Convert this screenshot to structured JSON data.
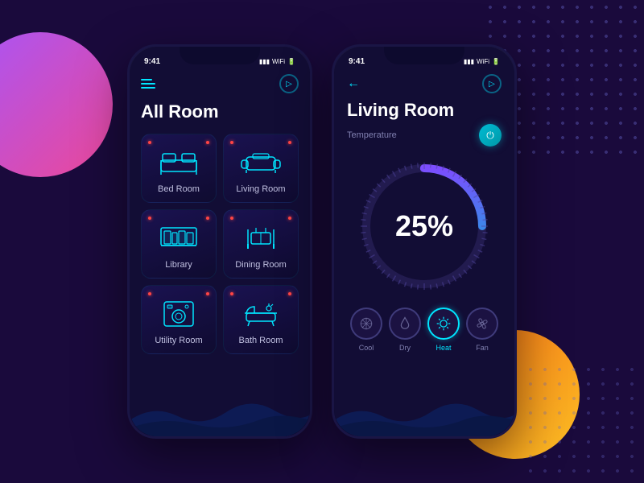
{
  "background": {
    "primaryColor": "#1a0a3c"
  },
  "phone1": {
    "statusBar": {
      "time": "9:41",
      "icons": "▮▮▮ ▲ ■"
    },
    "header": {
      "menuIcon": "hamburger",
      "locationIcon": "📍"
    },
    "title": "All Room",
    "rooms": [
      {
        "id": "bedroom",
        "name": "Bed Room",
        "icon": "bed"
      },
      {
        "id": "livingroom",
        "name": "Living Room",
        "icon": "sofa"
      },
      {
        "id": "library",
        "name": "Library",
        "icon": "books"
      },
      {
        "id": "diningroom",
        "name": "Dining Room",
        "icon": "dining"
      },
      {
        "id": "utilityroom",
        "name": "Utility Room",
        "icon": "washer"
      },
      {
        "id": "bathroom",
        "name": "Bath Room",
        "icon": "bath"
      }
    ]
  },
  "phone2": {
    "statusBar": {
      "time": "9:41",
      "icons": "▮▮▮ ▲ ■"
    },
    "header": {
      "backIcon": "←",
      "locationIcon": "📍"
    },
    "title": "Living Room",
    "tempLabel": "Temperature",
    "gaugeValue": "25%",
    "powerButton": "⏻",
    "controls": [
      {
        "id": "cool",
        "label": "Cool",
        "icon": "❄",
        "active": false
      },
      {
        "id": "dry",
        "label": "Dry",
        "icon": "💧",
        "active": false
      },
      {
        "id": "heat",
        "label": "Heat",
        "icon": "☀",
        "active": true
      },
      {
        "id": "fan",
        "label": "Fan",
        "icon": "✿",
        "active": false
      }
    ]
  }
}
